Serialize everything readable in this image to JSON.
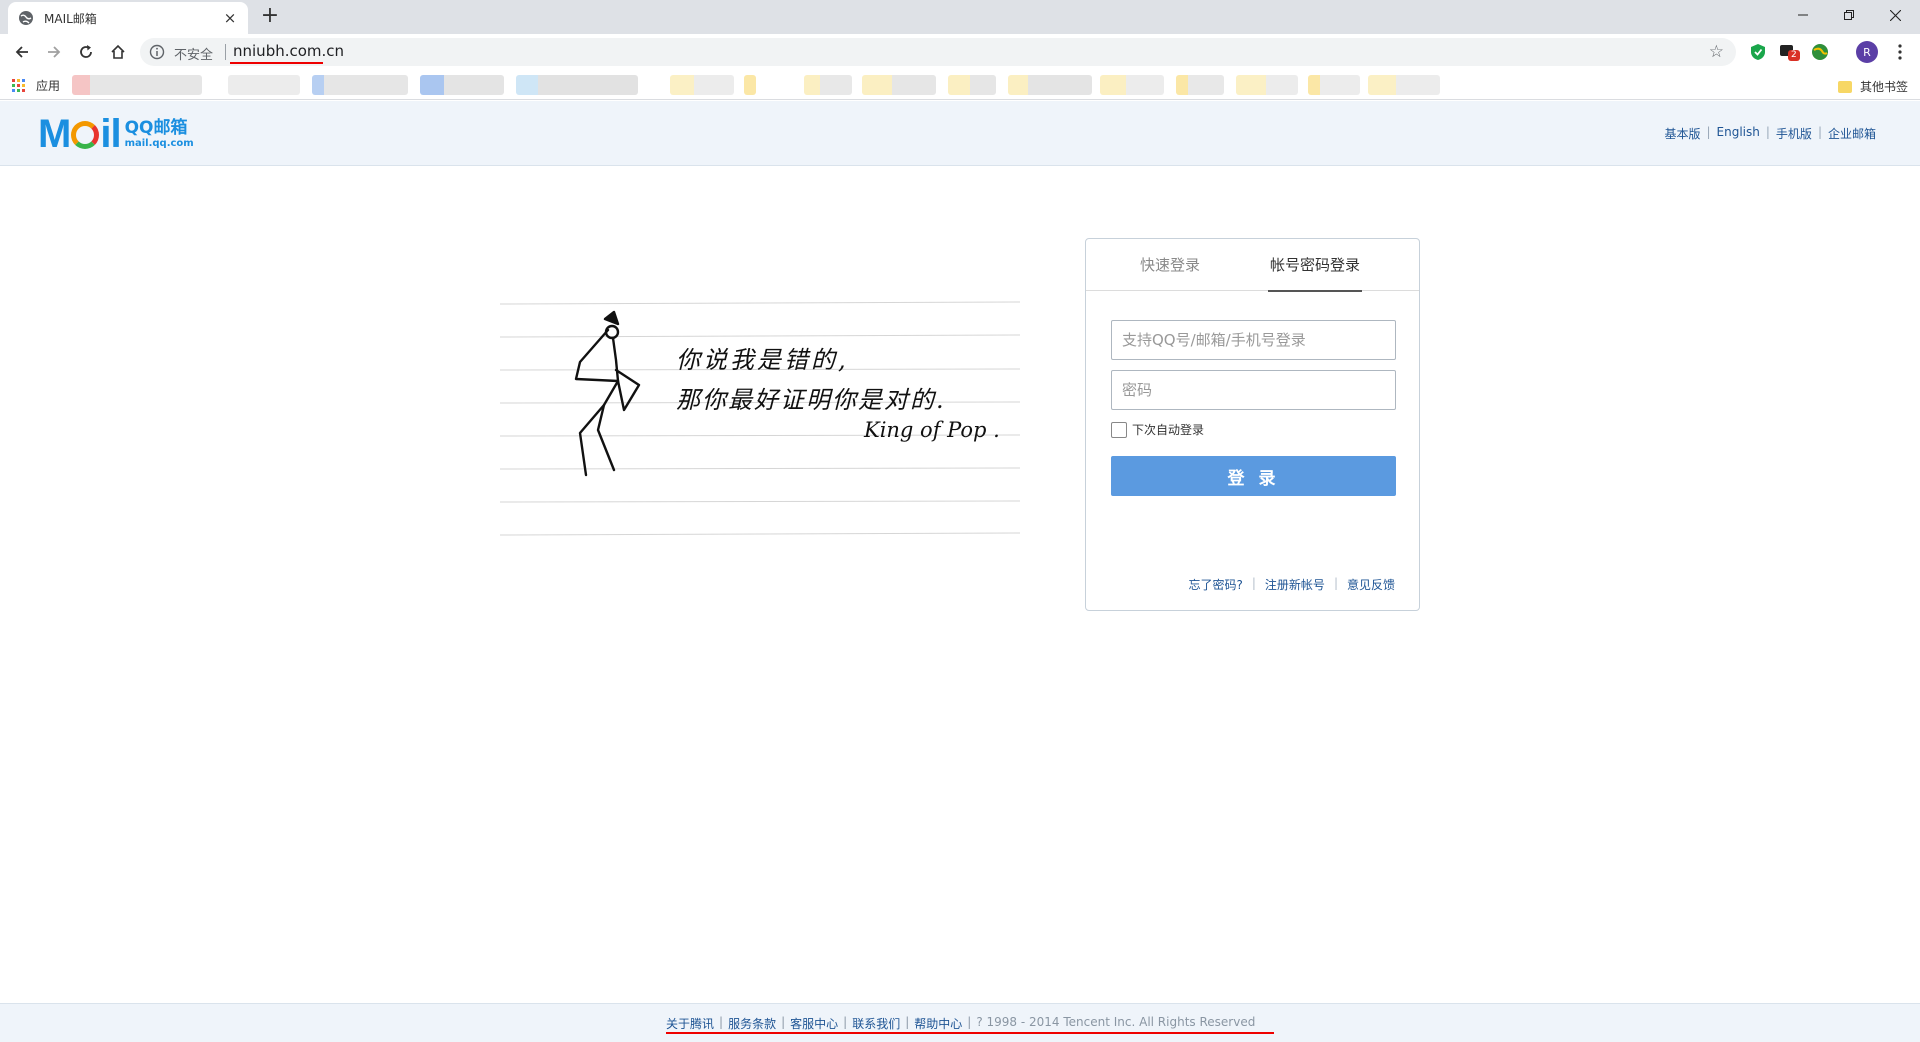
{
  "browser": {
    "tab_title": "MAIL邮箱",
    "tab_close": "×",
    "new_tab": "+",
    "security_label": "不安全",
    "url": "nniubh.com.cn",
    "bookmarks_apps": "应用",
    "bookmarks_other": "其他书签",
    "profile_initial": "R",
    "ext_badge": "2"
  },
  "header": {
    "logo_word_pre": "M",
    "logo_word_post": "il",
    "logo_name": "QQ邮箱",
    "logo_domain": "mail.qq.com",
    "links": [
      "基本版",
      "English",
      "手机版",
      "企业邮箱"
    ]
  },
  "artwork": {
    "line1": "你说我是错的,",
    "line2": "那你最好证明你是对的.",
    "signature": "King of Pop ."
  },
  "login": {
    "tab_quick": "快速登录",
    "tab_password": "帐号密码登录",
    "account_placeholder": "支持QQ号/邮箱/手机号登录",
    "password_placeholder": "密码",
    "remember_label": "下次自动登录",
    "login_button": "登 录",
    "forgot": "忘了密码?",
    "register": "注册新帐号",
    "feedback": "意见反馈"
  },
  "footer": {
    "links": [
      "关于腾讯",
      "服务条款",
      "客服中心",
      "联系我们",
      "帮助中心"
    ],
    "copyright": "? 1998 - 2014 Tencent Inc. All Rights Reserved"
  },
  "colors": {
    "accent": "#1b8fe0",
    "link": "#1e5494",
    "button": "#5b9ae0",
    "annotation_red": "#e00000"
  }
}
